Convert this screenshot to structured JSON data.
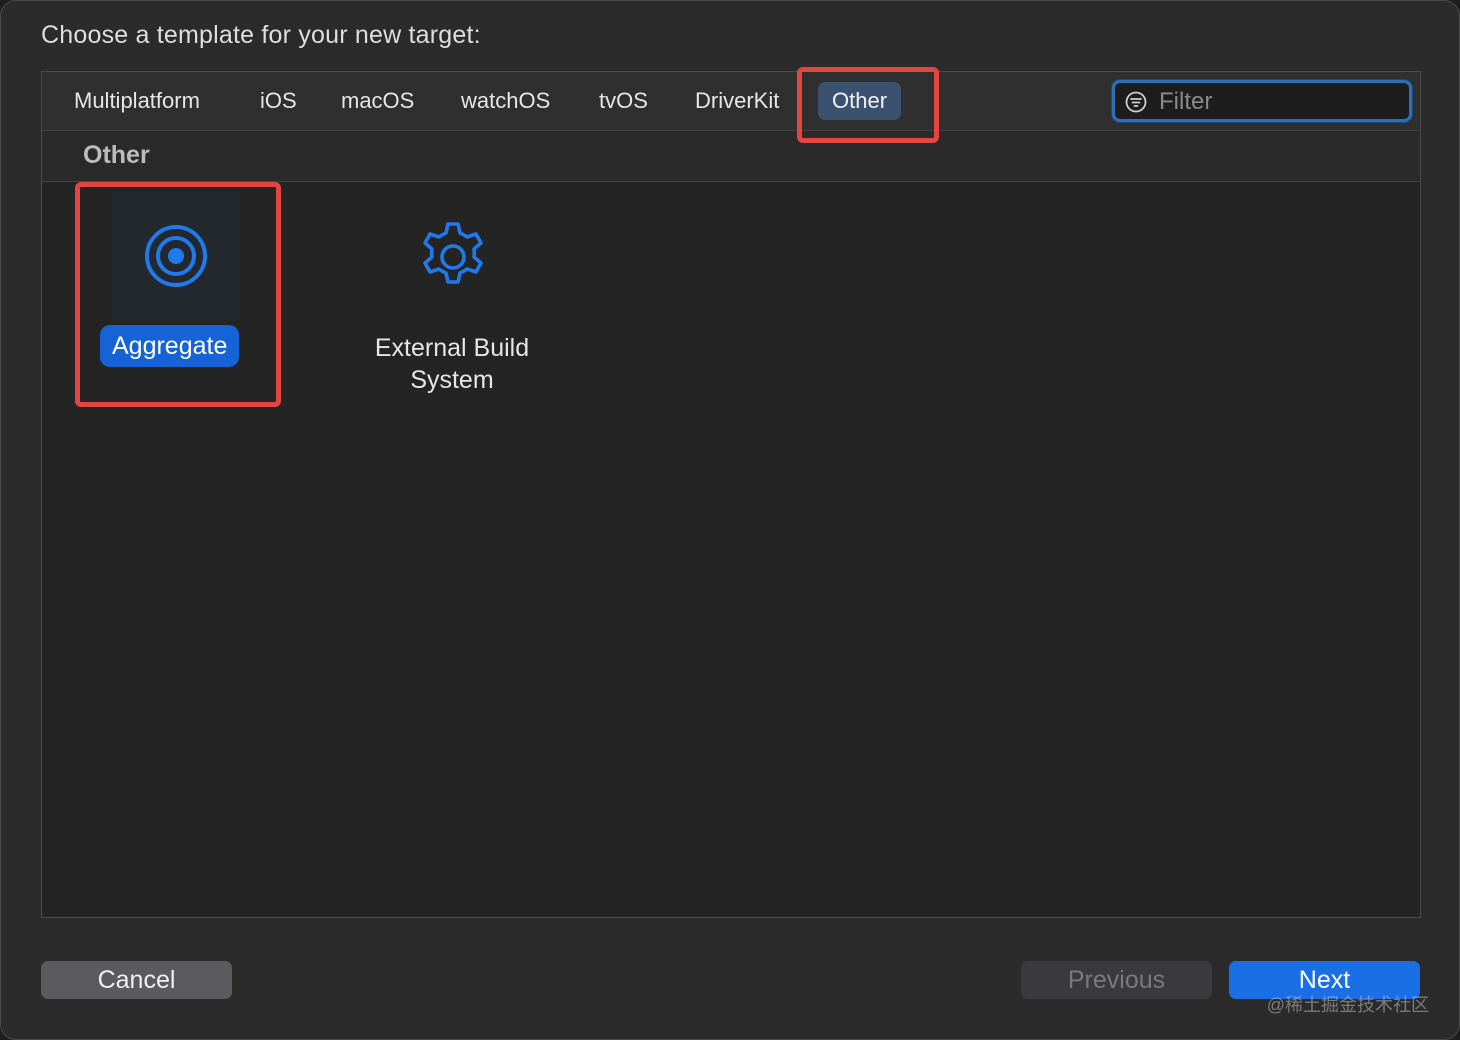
{
  "prompt": "Choose a template for your new target:",
  "tabs": [
    "Multiplatform",
    "iOS",
    "macOS",
    "watchOS",
    "tvOS",
    "DriverKit",
    "Other"
  ],
  "selected_tab": "Other",
  "filter": {
    "placeholder": "Filter",
    "value": "",
    "icon": "filter-icon"
  },
  "section": {
    "title": "Other"
  },
  "templates": [
    {
      "label": "Aggregate",
      "icon": "target-icon",
      "selected": true
    },
    {
      "label": "External Build\nSystem",
      "label_line1": "External Build",
      "label_line2": "System",
      "icon": "gear-icon",
      "selected": false
    }
  ],
  "buttons": {
    "cancel": "Cancel",
    "previous": "Previous",
    "next": "Next"
  },
  "watermark": "@稀土掘金技术社区",
  "colors": {
    "accent": "#1a6fe6",
    "selected_tab": "#3a5270",
    "annotation": "#e5453f",
    "icon_blue": "#1f7aeb"
  }
}
